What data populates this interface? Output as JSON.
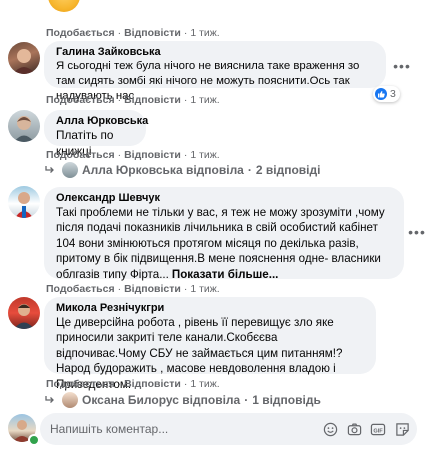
{
  "comments": [
    {
      "author": "",
      "actions": {
        "like": "Подобається",
        "reply": "Відповісти",
        "time": "1 тиж."
      }
    },
    {
      "author": "Галина Зайковська",
      "text": "Я сьогодні теж була нічого не вияснила таке враження зо там сидять зомбі які нічого не можуть пояснити.Ось так надувають нас",
      "actions": {
        "like": "Подобається",
        "reply": "Відповісти",
        "time": "1 тиж."
      },
      "reactions": "3"
    },
    {
      "author": "Алла Юрковська",
      "text": "Платіть по книжці",
      "actions": {
        "like": "Подобається",
        "reply": "Відповісти",
        "time": "1 тиж."
      },
      "reply_summary": "Алла Юрковська відповіла",
      "reply_count": "2 відповіді"
    },
    {
      "author": "Олександр Шевчук",
      "text": "Такі проблеми не тільки у вас, я теж не можу зрозуміти ,чому після подачі показників лічильника в свій особистий кабінет 104 вони змінюються протягом місяця по декілька разів, притому в бік підвищення.В мене пояснення одне- власники облгазів типу Фірта...",
      "more": "Показати більше...",
      "actions": {
        "like": "Подобається",
        "reply": "Відповісти",
        "time": "1 тиж."
      }
    },
    {
      "author": "Микола Резнічукгри",
      "text": "Це диверсійна робота , рівень її перевищує зло яке приносили закриті теле канали.Скобєєва відпочиває.Чому СБУ не займається цим питанням!? Народ будоражить , масове невдоволення владою і Призедентом.",
      "actions": {
        "like": "Подобається",
        "reply": "Відповісти",
        "time": "1 тиж."
      },
      "reply_summary": "Оксана Билорус відповіла",
      "reply_count": "1 відповідь"
    }
  ],
  "composer": {
    "placeholder": "Напишіть коментар..."
  },
  "colors": {
    "bubble": "#f0f2f5",
    "meta": "#65676b",
    "like_blue": "#1877f2",
    "online": "#31a24c"
  },
  "icons": [
    "more-options-icon",
    "like-reaction-icon",
    "reply-arrow-icon",
    "emoji-icon",
    "camera-icon",
    "gif-icon",
    "sticker-icon"
  ]
}
